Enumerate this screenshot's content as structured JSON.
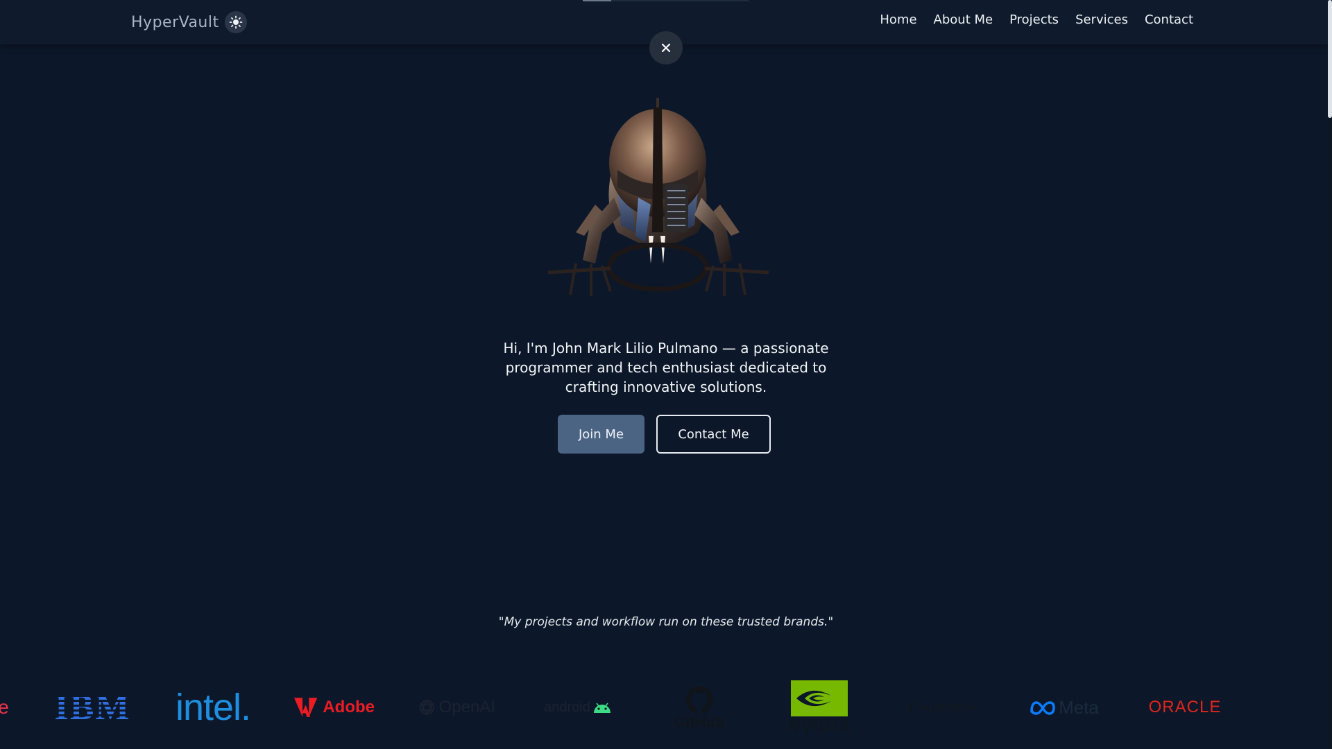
{
  "header": {
    "logo_text": "HyperVault",
    "theme_icon": "sun-icon",
    "loading_progress_percent": 17,
    "nav": [
      {
        "label": "Home"
      },
      {
        "label": "About Me"
      },
      {
        "label": "Projects"
      },
      {
        "label": "Services"
      },
      {
        "label": "Contact"
      }
    ]
  },
  "overlay": {
    "close_icon": "close-icon"
  },
  "hero": {
    "illustration": "robot-illustration",
    "intro": "Hi, I'm John Mark Lilio Pulmano — a passionate programmer and tech enthusiast dedicated to crafting innovative solutions.",
    "primary_button": "Join Me",
    "secondary_button": "Contact Me"
  },
  "brands": {
    "quote": "\"My projects and workflow run on these trusted brands.\"",
    "logos": [
      {
        "name": "e",
        "color": "#e8334a"
      },
      {
        "name": "IBM",
        "color": "#2f6fe0"
      },
      {
        "name": "intel.",
        "color": "#1e8fe0"
      },
      {
        "name": "Adobe",
        "color": "#eb1c24"
      },
      {
        "name": "OpenAI",
        "color": "#1a2230"
      },
      {
        "name": "android",
        "color": "#3ddc84"
      },
      {
        "name": "GitHub",
        "color": "#10151c"
      },
      {
        "name": "NVIDIA",
        "color": "#76b900"
      },
      {
        "name": "AUTODESK",
        "color": "#0e1620"
      },
      {
        "name": "Meta",
        "color": "#0a7cff"
      },
      {
        "name": "ORACLE",
        "color": "#e0251d"
      }
    ]
  },
  "colors": {
    "background": "#0c1829",
    "header_background": "#0f1b2c",
    "primary_button": "#4b6483",
    "text": "#e8edf3"
  }
}
